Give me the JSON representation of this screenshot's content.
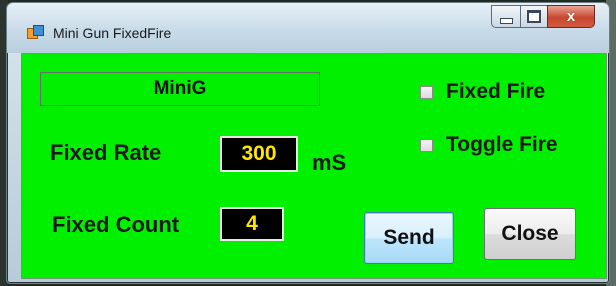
{
  "window": {
    "title": "Mini Gun FixedFire",
    "icon": "app-form-icon"
  },
  "caption_buttons": {
    "minimize_icon": "minimize-icon",
    "maximize_icon": "maximize-icon",
    "close_glyph": "x"
  },
  "form": {
    "device_name": "MiniG",
    "fixed_rate": {
      "label": "Fixed Rate",
      "value": "300",
      "unit": "mS"
    },
    "fixed_count": {
      "label": "Fixed Count",
      "value": "4"
    },
    "fixed_fire": {
      "label": "Fixed Fire",
      "checked": false
    },
    "toggle_fire": {
      "label": "Toggle Fire",
      "checked": false
    },
    "send_label": "Send",
    "close_label": "Close"
  },
  "colors": {
    "client_background": "#00f000",
    "value_text": "#ffe600",
    "value_background": "#000000"
  }
}
